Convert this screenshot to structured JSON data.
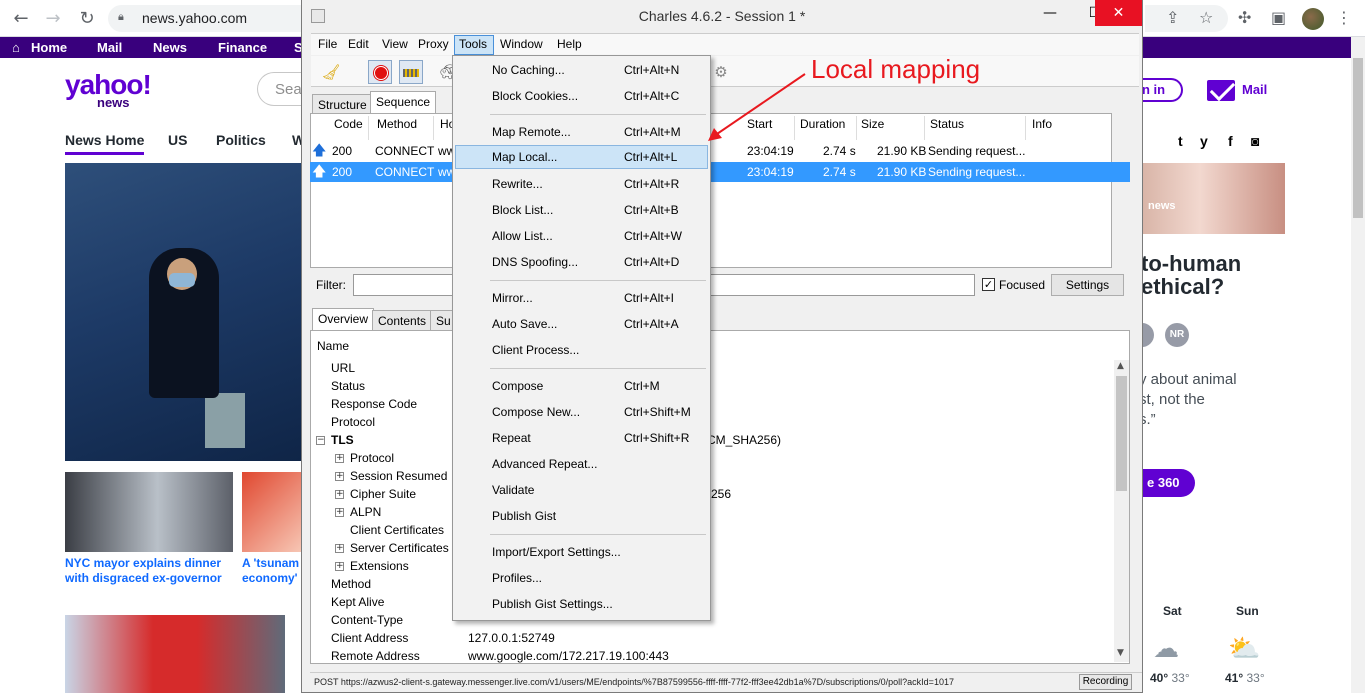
{
  "browser": {
    "url": "news.yahoo.com"
  },
  "yahoo": {
    "topnav": [
      "Home",
      "Mail",
      "News",
      "Finance",
      "S"
    ],
    "logo": "yahoo!",
    "logo_sub": "news",
    "search_placeholder": "Sea",
    "sections": [
      "News Home",
      "US",
      "Politics",
      "W"
    ],
    "headline1_l1": "NYC mayor explains dinner",
    "headline1_l2": "with disgraced ex-governor",
    "headline2_l1": "A 'tsunam",
    "headline2_l2": "economy'",
    "signin": "n in",
    "mail": "Mail",
    "social": [
      "t",
      "y",
      "f",
      "◙"
    ],
    "news_tag": "news",
    "big_head_l1": "to-human",
    "big_head_l2": "ethical?",
    "nr": "NR",
    "quote_l1": "y about animal",
    "quote_l2": "st, not the",
    "quote_l3": "s.”",
    "pill360": "e 360",
    "weather": [
      {
        "day": "Sat",
        "high": "40°",
        "low": "33°"
      },
      {
        "day": "Sun",
        "high": "41°",
        "low": "33°"
      }
    ]
  },
  "charles": {
    "title": "Charles 4.6.2 - Session 1 *",
    "menus": [
      "File",
      "Edit",
      "View",
      "Proxy",
      "Tools",
      "Window",
      "Help"
    ],
    "tabs": [
      "Structure",
      "Sequence"
    ],
    "columns": [
      "Code",
      "Method",
      "Ho",
      "Start",
      "Duration",
      "Size",
      "Status",
      "Info"
    ],
    "rows": [
      {
        "code": "200",
        "method": "CONNECT",
        "host": "ww",
        "start": "23:04:19",
        "duration": "2.74 s",
        "size": "21.90 KB",
        "status": "Sending request..."
      },
      {
        "code": "200",
        "method": "CONNECT",
        "host": "ww",
        "start": "23:04:19",
        "duration": "2.74 s",
        "size": "21.90 KB",
        "status": "Sending request..."
      }
    ],
    "filter_label": "Filter:",
    "focused": "Focused",
    "settings": "Settings",
    "detail_tabs": [
      "Overview",
      "Contents",
      "Su"
    ],
    "detail_header": "Name",
    "detail_rows": [
      {
        "label": "URL"
      },
      {
        "label": "Status"
      },
      {
        "label": "Response Code"
      },
      {
        "label": "Protocol"
      },
      {
        "label": "TLS",
        "bold": true,
        "value": "CM_SHA256)"
      },
      {
        "label": "Protocol"
      },
      {
        "label": "Session Resumed"
      },
      {
        "label": "Cipher Suite",
        "value": "256"
      },
      {
        "label": "ALPN"
      },
      {
        "label": "Client Certificates"
      },
      {
        "label": "Server Certificates"
      },
      {
        "label": "Extensions"
      },
      {
        "label": "Method"
      },
      {
        "label": "Kept Alive"
      },
      {
        "label": "Content-Type"
      },
      {
        "label": "Client Address",
        "value": "127.0.0.1:52749"
      },
      {
        "label": "Remote Address",
        "value": "www.google.com/172.217.19.100:443"
      }
    ],
    "status_url": "POST https://azwus2-client-s.gateway.messenger.live.com/v1/users/ME/endpoints/%7B87599556-ffff-ffff-77f2-fff3ee42db1a%7D/subscriptions/0/poll?ackId=1017",
    "recording": "Recording"
  },
  "tools_menu": [
    {
      "label": "No Caching...",
      "shortcut": "Ctrl+Alt+N"
    },
    {
      "label": "Block Cookies...",
      "shortcut": "Ctrl+Alt+C"
    },
    {
      "label": "Map Remote...",
      "shortcut": "Ctrl+Alt+M"
    },
    {
      "label": "Map Local...",
      "shortcut": "Ctrl+Alt+L"
    },
    {
      "label": "Rewrite...",
      "shortcut": "Ctrl+Alt+R"
    },
    {
      "label": "Block List...",
      "shortcut": "Ctrl+Alt+B"
    },
    {
      "label": "Allow List...",
      "shortcut": "Ctrl+Alt+W"
    },
    {
      "label": "DNS Spoofing...",
      "shortcut": "Ctrl+Alt+D"
    },
    {
      "label": "Mirror...",
      "shortcut": "Ctrl+Alt+I"
    },
    {
      "label": "Auto Save...",
      "shortcut": "Ctrl+Alt+A"
    },
    {
      "label": "Client Process...",
      "shortcut": ""
    },
    {
      "label": "Compose",
      "shortcut": "Ctrl+M"
    },
    {
      "label": "Compose New...",
      "shortcut": "Ctrl+Shift+M"
    },
    {
      "label": "Repeat",
      "shortcut": "Ctrl+Shift+R"
    },
    {
      "label": "Advanced Repeat...",
      "shortcut": ""
    },
    {
      "label": "Validate",
      "shortcut": ""
    },
    {
      "label": "Publish Gist",
      "shortcut": ""
    },
    {
      "label": "Import/Export Settings...",
      "shortcut": ""
    },
    {
      "label": "Profiles...",
      "shortcut": ""
    },
    {
      "label": "Publish Gist Settings...",
      "shortcut": ""
    }
  ],
  "annotation": "Local mapping",
  "colors": {
    "yahoo_purple": "#6001d2",
    "yahoo_nav": "#39007d",
    "selection_blue": "#3399ff",
    "annotation_red": "#e8191f"
  }
}
